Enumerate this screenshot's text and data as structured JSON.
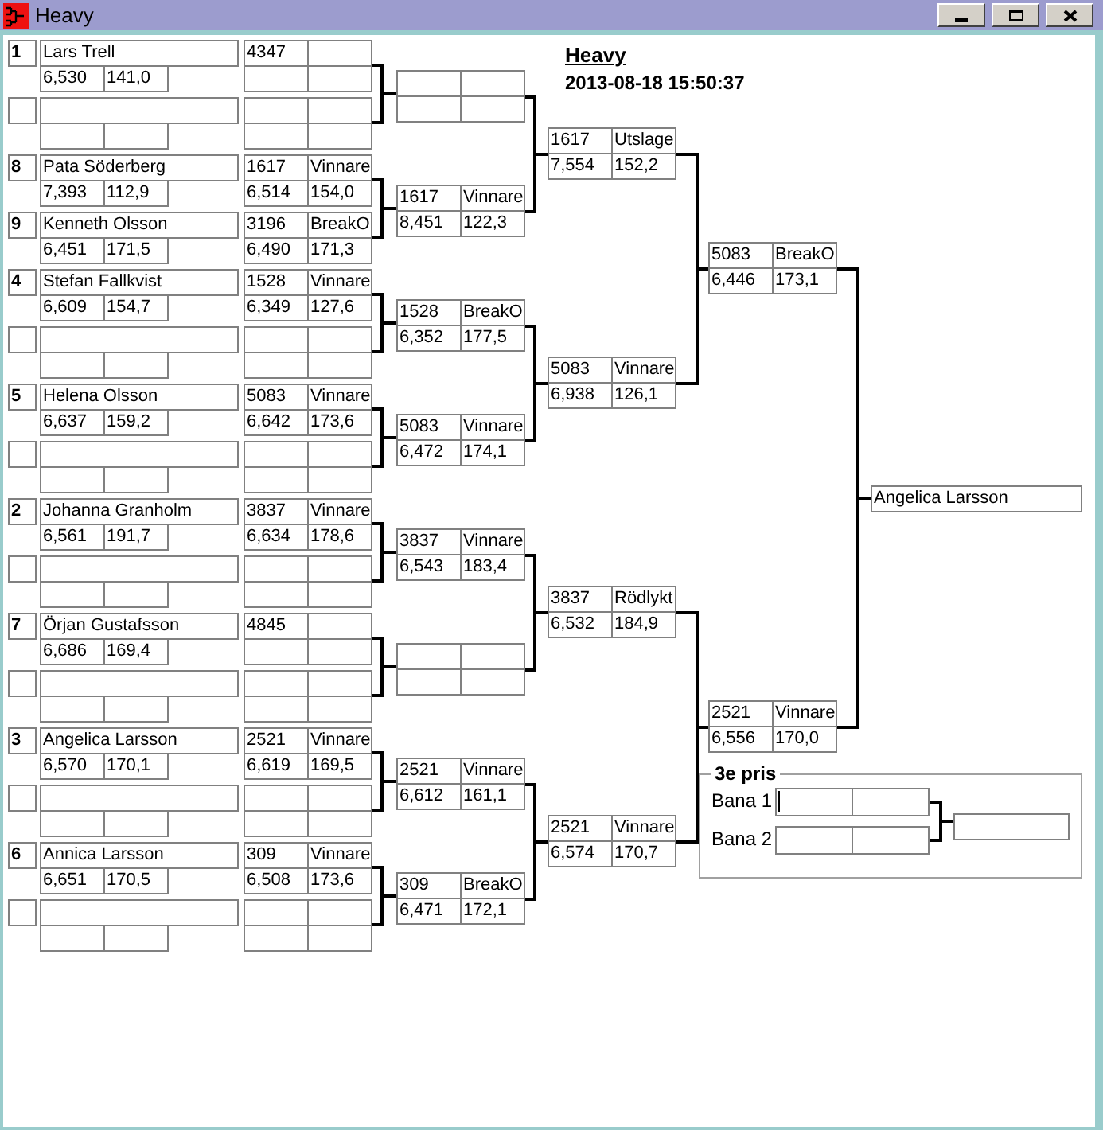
{
  "window": {
    "title": "Heavy"
  },
  "header": {
    "title": "Heavy",
    "timestamp": "2013-08-18 15:50:37"
  },
  "round_1": [
    {
      "top": {
        "seed": "1",
        "name": "Lars Trell",
        "reaction": "6,530",
        "speed": "141,0",
        "car": "4347"
      }
    },
    {
      "top": {
        "seed": "8",
        "name": "Pata Söderberg",
        "reaction": "7,393",
        "speed": "112,9",
        "car": "1617",
        "result": "Vinnare",
        "time": "6,514",
        "run_speed": "154,0"
      },
      "bottom": {
        "seed": "9",
        "name": "Kenneth Olsson",
        "reaction": "6,451",
        "speed": "171,5",
        "car": "3196",
        "result": "BreakO",
        "time": "6,490",
        "run_speed": "171,3"
      }
    },
    {
      "top": {
        "seed": "4",
        "name": "Stefan Fallkvist",
        "reaction": "6,609",
        "speed": "154,7",
        "car": "1528",
        "result": "Vinnare",
        "time": "6,349",
        "run_speed": "127,6"
      }
    },
    {
      "top": {
        "seed": "5",
        "name": "Helena Olsson",
        "reaction": "6,637",
        "speed": "159,2",
        "car": "5083",
        "result": "Vinnare",
        "time": "6,642",
        "run_speed": "173,6"
      }
    },
    {
      "top": {
        "seed": "2",
        "name": "Johanna Granholm",
        "reaction": "6,561",
        "speed": "191,7",
        "car": "3837",
        "result": "Vinnare",
        "time": "6,634",
        "run_speed": "178,6"
      }
    },
    {
      "top": {
        "seed": "7",
        "name": "Örjan Gustafsson",
        "reaction": "6,686",
        "speed": "169,4",
        "car": "4845"
      }
    },
    {
      "top": {
        "seed": "3",
        "name": "Angelica Larsson",
        "reaction": "6,570",
        "speed": "170,1",
        "car": "2521",
        "result": "Vinnare",
        "time": "6,619",
        "run_speed": "169,5"
      }
    },
    {
      "top": {
        "seed": "6",
        "name": "Annica Larsson",
        "reaction": "6,651",
        "speed": "170,5",
        "car": "309",
        "result": "Vinnare",
        "time": "6,508",
        "run_speed": "173,6"
      }
    }
  ],
  "round_2": [
    {
      "kind": "empty"
    },
    {
      "kind": "result",
      "car": "1617",
      "result": "Vinnare",
      "time": "8,451",
      "run_speed": "122,3"
    },
    {
      "kind": "result",
      "car": "1528",
      "result": "BreakO",
      "time": "6,352",
      "run_speed": "177,5"
    },
    {
      "kind": "result",
      "car": "5083",
      "result": "Vinnare",
      "time": "6,472",
      "run_speed": "174,1"
    },
    {
      "kind": "result",
      "car": "3837",
      "result": "Vinnare",
      "time": "6,543",
      "run_speed": "183,4"
    },
    {
      "kind": "empty"
    },
    {
      "kind": "result",
      "car": "2521",
      "result": "Vinnare",
      "time": "6,612",
      "run_speed": "161,1"
    },
    {
      "kind": "result",
      "car": "309",
      "result": "BreakO",
      "time": "6,471",
      "run_speed": "172,1"
    }
  ],
  "round_3": [
    {
      "car": "1617",
      "result": "Utslage",
      "time": "7,554",
      "run_speed": "152,2"
    },
    {
      "car": "5083",
      "result": "Vinnare",
      "time": "6,938",
      "run_speed": "126,1"
    },
    {
      "car": "3837",
      "result": "Rödlykt",
      "time": "6,532",
      "run_speed": "184,9"
    },
    {
      "car": "2521",
      "result": "Vinnare",
      "time": "6,574",
      "run_speed": "170,7"
    }
  ],
  "round_4": [
    {
      "car": "5083",
      "result": "BreakO",
      "time": "6,446",
      "run_speed": "173,1"
    },
    {
      "car": "2521",
      "result": "Vinnare",
      "time": "6,556",
      "run_speed": "170,0"
    }
  ],
  "winner": {
    "name": "Angelica Larsson"
  },
  "third_place": {
    "title": "3e pris",
    "lanes": [
      {
        "label": "Bana 1",
        "focused": true
      },
      {
        "label": "Bana 2",
        "focused": false
      }
    ]
  }
}
